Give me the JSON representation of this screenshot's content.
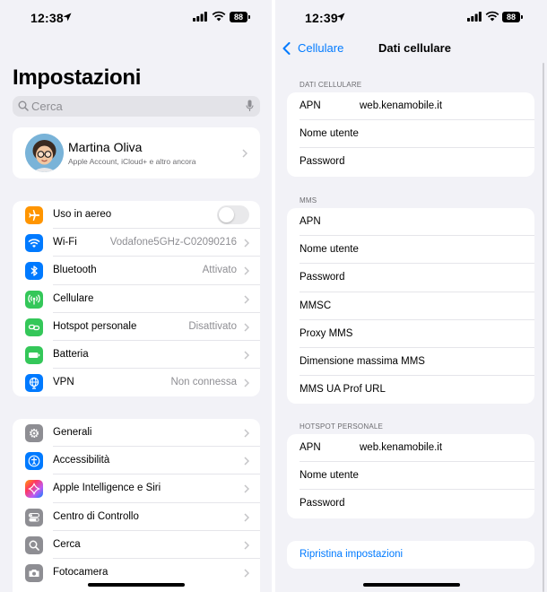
{
  "status_bar": {
    "time_left": "12:38",
    "time_right": "12:39",
    "battery": "88"
  },
  "settings": {
    "title": "Impostazioni",
    "search_placeholder": "Cerca",
    "profile": {
      "name": "Martina Oliva",
      "subtitle": "Apple Account, iCloud+ e altro ancora"
    },
    "group1": [
      {
        "label": "Uso in aereo",
        "value": "",
        "icon": "airplane-icon",
        "color": "#ff9500"
      },
      {
        "label": "Wi-Fi",
        "value": "Vodafone5GHz-C02090216",
        "icon": "wifi-icon",
        "color": "#007aff"
      },
      {
        "label": "Bluetooth",
        "value": "Attivato",
        "icon": "bluetooth-icon",
        "color": "#007aff"
      },
      {
        "label": "Cellulare",
        "value": "",
        "icon": "antenna-icon",
        "color": "#34c759"
      },
      {
        "label": "Hotspot personale",
        "value": "Disattivato",
        "icon": "hotspot-icon",
        "color": "#34c759"
      },
      {
        "label": "Batteria",
        "value": "",
        "icon": "battery-icon",
        "color": "#34c759"
      },
      {
        "label": "VPN",
        "value": "Non connessa",
        "icon": "globe-icon",
        "color": "#007aff"
      }
    ],
    "group2": [
      {
        "label": "Generali",
        "icon": "gear-icon",
        "color": "#8e8e93"
      },
      {
        "label": "Accessibilità",
        "icon": "accessibility-icon",
        "color": "#007aff"
      },
      {
        "label": "Apple Intelligence e Siri",
        "icon": "siri-icon",
        "color": "#af52de"
      },
      {
        "label": "Centro di Controllo",
        "icon": "toggles-icon",
        "color": "#8e8e93"
      },
      {
        "label": "Cerca",
        "icon": "search-icon",
        "color": "#8e8e93"
      },
      {
        "label": "Fotocamera",
        "icon": "camera-icon",
        "color": "#8e8e93"
      }
    ]
  },
  "cellular": {
    "back_label": "Cellulare",
    "title": "Dati cellulare",
    "sections": [
      {
        "header": "DATI CELLULARE",
        "fields": [
          {
            "label": "APN",
            "value": "web.kenamobile.it"
          },
          {
            "label": "Nome utente",
            "value": ""
          },
          {
            "label": "Password",
            "value": ""
          }
        ]
      },
      {
        "header": "MMS",
        "fields": [
          {
            "label": "APN",
            "value": ""
          },
          {
            "label": "Nome utente",
            "value": ""
          },
          {
            "label": "Password",
            "value": ""
          },
          {
            "label": "MMSC",
            "value": ""
          },
          {
            "label": "Proxy MMS",
            "value": ""
          },
          {
            "label": "Dimensione massima MMS",
            "value": ""
          },
          {
            "label": "MMS UA Prof URL",
            "value": ""
          }
        ]
      },
      {
        "header": "HOTSPOT PERSONALE",
        "fields": [
          {
            "label": "APN",
            "value": "web.kenamobile.it"
          },
          {
            "label": "Nome utente",
            "value": ""
          },
          {
            "label": "Password",
            "value": ""
          }
        ]
      }
    ],
    "reset_label": "Ripristina impostazioni"
  },
  "colors": {
    "accent": "#007aff",
    "background": "#f2f2f7",
    "secondary_text": "#8e8e93"
  }
}
